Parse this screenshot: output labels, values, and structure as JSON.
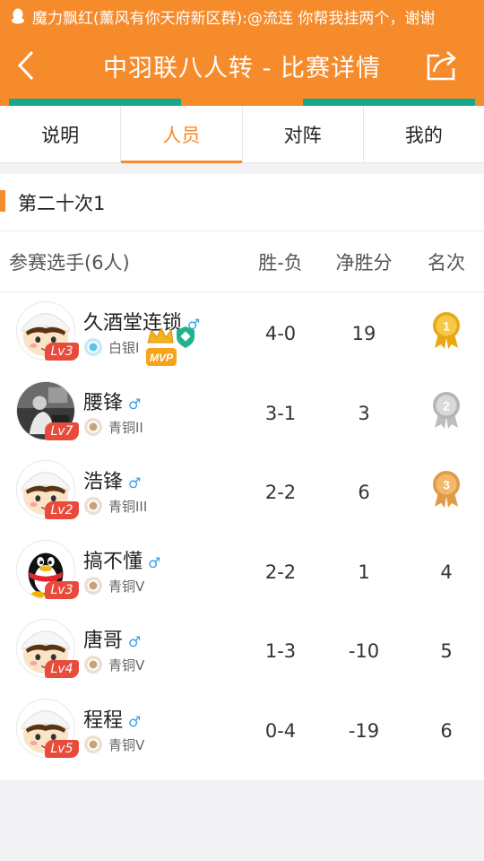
{
  "notification": {
    "text": "魔力飘红(薰风有你天府新区群):@流连 你帮我挂两个，谢谢"
  },
  "header": {
    "title": "中羽联八人转 - 比赛详情"
  },
  "tabs": [
    {
      "label": "说明",
      "active": false
    },
    {
      "label": "人员",
      "active": true
    },
    {
      "label": "对阵",
      "active": false
    },
    {
      "label": "我的",
      "active": false
    }
  ],
  "section": {
    "title": "第二十次1"
  },
  "table": {
    "headers": {
      "players": "参赛选手(6人)",
      "win_loss": "胜-负",
      "net_points": "净胜分",
      "rank": "名次"
    },
    "rows": [
      {
        "name": "久酒堂连锁",
        "gender": "♂",
        "level": "Lv3",
        "tier": "白银I",
        "tier_color": "#5bc4e8",
        "win_loss": "4-0",
        "net": "19",
        "rank": "1",
        "medal": "gold",
        "avatar": "cartoon",
        "badges": "MVP"
      },
      {
        "name": "腰锋",
        "gender": "♂",
        "level": "Lv7",
        "tier": "青铜II",
        "tier_color": "#c9a27a",
        "win_loss": "3-1",
        "net": "3",
        "rank": "2",
        "medal": "silver",
        "avatar": "photo"
      },
      {
        "name": "浩锋",
        "gender": "♂",
        "level": "Lv2",
        "tier": "青铜III",
        "tier_color": "#c9a27a",
        "win_loss": "2-2",
        "net": "6",
        "rank": "3",
        "medal": "bronze",
        "avatar": "cartoon"
      },
      {
        "name": "搞不懂",
        "gender": "♂",
        "level": "Lv3",
        "tier": "青铜V",
        "tier_color": "#c9a27a",
        "win_loss": "2-2",
        "net": "1",
        "rank": "4",
        "medal": "",
        "avatar": "penguin"
      },
      {
        "name": "唐哥",
        "gender": "♂",
        "level": "Lv4",
        "tier": "青铜V",
        "tier_color": "#c9a27a",
        "win_loss": "1-3",
        "net": "-10",
        "rank": "5",
        "medal": "",
        "avatar": "cartoon"
      },
      {
        "name": "程程",
        "gender": "♂",
        "level": "Lv5",
        "tier": "青铜V",
        "tier_color": "#c9a27a",
        "win_loss": "0-4",
        "net": "-19",
        "rank": "6",
        "medal": "",
        "avatar": "cartoon"
      }
    ]
  },
  "colors": {
    "accent": "#f68b2c",
    "green": "#14a889",
    "level_badge": "#e84b3c",
    "male": "#3aa0e6"
  }
}
